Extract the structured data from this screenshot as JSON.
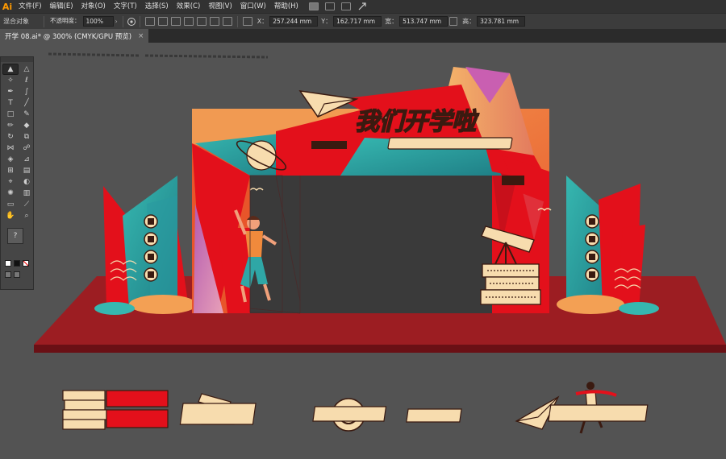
{
  "app": {
    "logo": "Ai",
    "menu": [
      "文件(F)",
      "编辑(E)",
      "对象(O)",
      "文字(T)",
      "选择(S)",
      "效果(C)",
      "视图(V)",
      "窗口(W)",
      "帮助(H)"
    ]
  },
  "control": {
    "mode_label": "混合对象",
    "opacity_label": "不透明度：",
    "opacity_value": "100%",
    "x_label": "X：",
    "x_value": "257.244",
    "y_label": "Y：",
    "y_value": "162.717",
    "w_label": "宽：",
    "w_value": "513.747",
    "h_label": "高：",
    "h_value": "323.781",
    "unit": "mm"
  },
  "document_tab": {
    "title": "开学 08.ai* @ 300% (CMYK/GPU 预览)",
    "close": "×"
  },
  "artwork": {
    "headline": "我们开学啦",
    "colors": {
      "red": "#e3101b",
      "deep_red": "#8a1820",
      "orange": "#f08a3c",
      "teal": "#2fa7a6",
      "purple": "#9a4fa3",
      "cream": "#f7dcae",
      "dark_brown": "#3a1a10"
    }
  },
  "icons": [
    "selection-tool",
    "direct-selection-tool",
    "magic-wand-tool",
    "lasso-tool",
    "pen-tool",
    "curvature-tool",
    "type-tool",
    "line-tool",
    "rectangle-tool",
    "paintbrush-tool",
    "pencil-tool",
    "eraser-tool",
    "rotate-tool",
    "scale-tool",
    "width-tool",
    "warp-tool",
    "shape-builder-tool",
    "perspective-tool",
    "mesh-tool",
    "gradient-tool",
    "eyedropper-tool",
    "blend-tool",
    "symbol-sprayer-tool",
    "column-graph-tool",
    "artboard-tool",
    "slice-tool",
    "hand-tool",
    "zoom-tool"
  ]
}
